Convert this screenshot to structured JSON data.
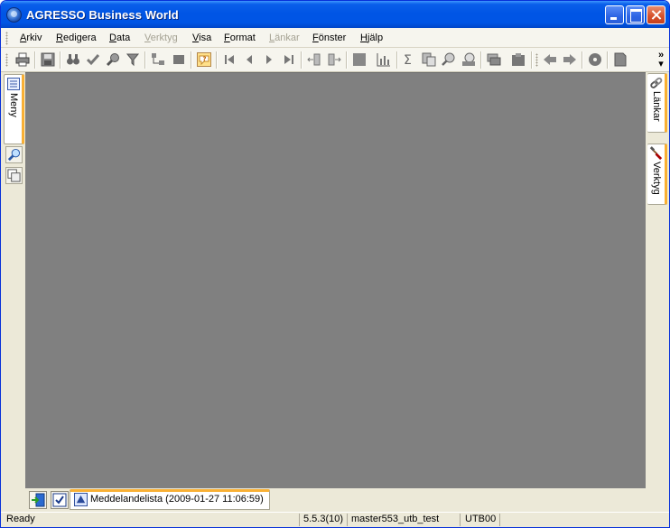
{
  "window": {
    "title": "AGRESSO Business World"
  },
  "menu": {
    "items": [
      {
        "label": "Arkiv",
        "enabled": true
      },
      {
        "label": "Redigera",
        "enabled": true
      },
      {
        "label": "Data",
        "enabled": true
      },
      {
        "label": "Verktyg",
        "enabled": false
      },
      {
        "label": "Visa",
        "enabled": true
      },
      {
        "label": "Format",
        "enabled": true
      },
      {
        "label": "Länkar",
        "enabled": false
      },
      {
        "label": "Fönster",
        "enabled": true
      },
      {
        "label": "Hjälp",
        "enabled": true
      }
    ]
  },
  "toolbar": {
    "overflow": "»",
    "icons": [
      "print-icon",
      "save-icon",
      "find-icon",
      "check-icon",
      "search-icon",
      "filter-icon",
      "tree-icon",
      "stop-icon",
      "help-icon",
      "first-record-icon",
      "previous-record-icon",
      "next-record-icon",
      "last-record-icon",
      "expand-icon",
      "collapse-icon",
      "grid-icon",
      "bar-chart-icon",
      "sum-icon",
      "copy-icon",
      "zoom-icon",
      "preview-icon",
      "windows-icon",
      "clipboard-icon",
      "back-arrow-icon",
      "forward-arrow-icon",
      "cd-icon",
      "document-icon"
    ]
  },
  "left_panel": {
    "tab_label": "Meny"
  },
  "right_panel": {
    "tabs": [
      {
        "label": "Länkar"
      },
      {
        "label": "Verktyg"
      }
    ]
  },
  "taskbar": {
    "document_tab": "Meddelandelista (2009-01-27 11:06:59)"
  },
  "status": {
    "text": "Ready",
    "version": "5.5.3(10)",
    "database": "master553_utb_test",
    "client": "UTB00"
  },
  "colors": {
    "titlebar": "#0055e5",
    "workspace": "#808080",
    "accent": "#f9b034",
    "chrome": "#ece9d8"
  }
}
